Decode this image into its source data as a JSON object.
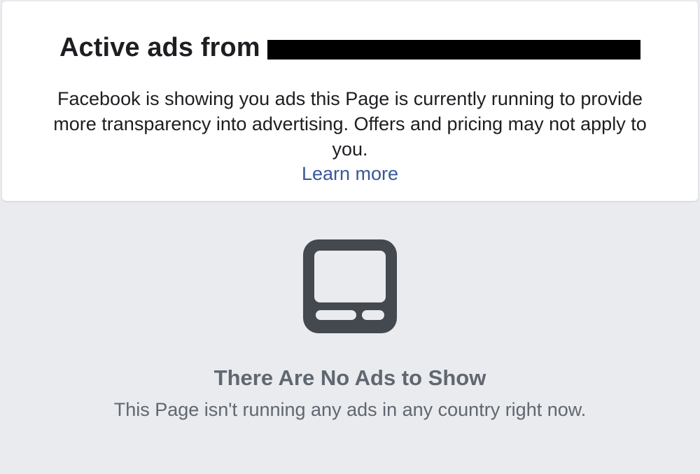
{
  "header": {
    "title_prefix": "Active ads from",
    "description": "Facebook is showing you ads this Page is currently running to provide more transparency into advertising. Offers and pricing may not apply to you.",
    "learn_more": "Learn more"
  },
  "empty_state": {
    "icon": "ad-placeholder-icon",
    "title": "There Are No Ads to Show",
    "subtitle": "This Page isn't running any ads in any country right now."
  },
  "colors": {
    "background": "#e9ebee",
    "card": "#ffffff",
    "link": "#385898",
    "muted_text": "#606770",
    "icon": "#444950"
  }
}
